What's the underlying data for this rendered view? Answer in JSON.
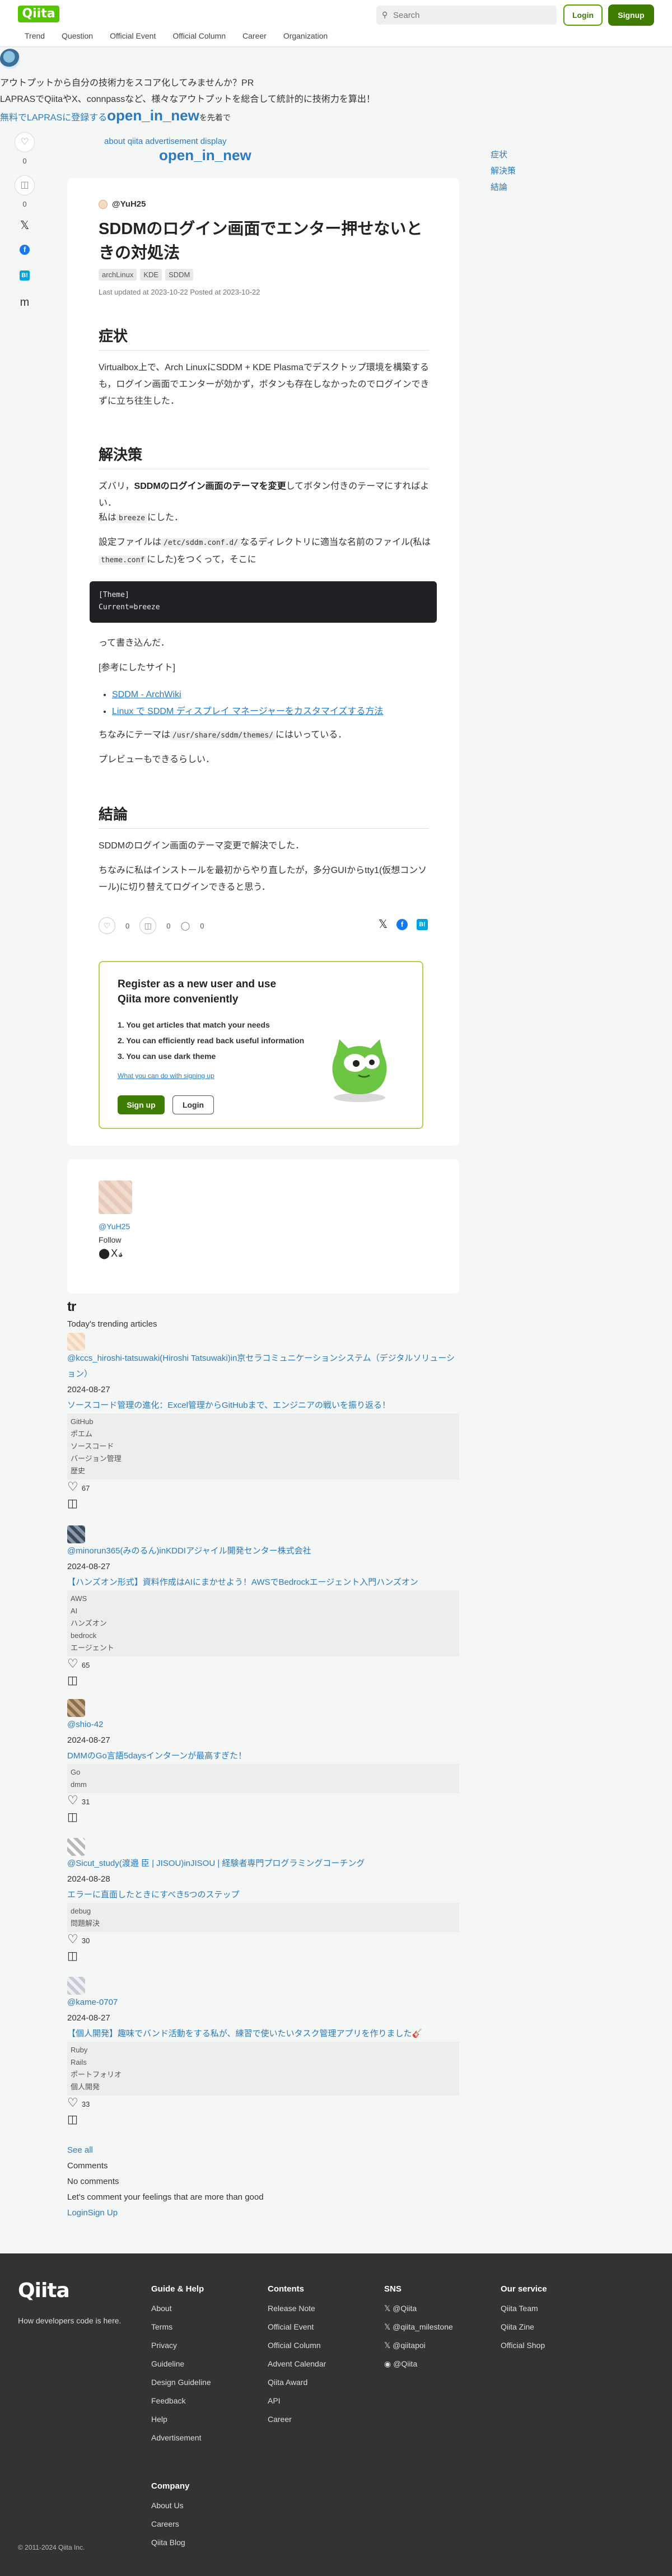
{
  "header": {
    "logo": "Qiita",
    "search_placeholder": "Search",
    "login": "Login",
    "signup": "Signup",
    "nav": [
      "Trend",
      "Question",
      "Official Event",
      "Official Column",
      "Career",
      "Organization"
    ]
  },
  "promo": {
    "line1": "アウトプットから自分の技術力をスコア化してみませんか？PR",
    "line2": "LAPRASでQiitaやX、connpassなど、様々なアウトプットを総合して統計的に技術力を算出！",
    "line3_link": "無料でLAPRASに登録する",
    "line3_big": "open_in_new",
    "line3_small": "を先着で"
  },
  "side_actions": {
    "like_count": "0",
    "stock_count": "0"
  },
  "ad": {
    "label": "about qiita advertisement display",
    "big": "open_in_new"
  },
  "toc": [
    "症状",
    "解決策",
    "結論"
  ],
  "article": {
    "author": "@YuH25",
    "title": "SDDMのログイン画面でエンター押せないときの対処法",
    "tags": [
      "archLinux",
      "KDE",
      "SDDM"
    ],
    "dates": "Last updated at 2023-10-22   Posted at 2023-10-22",
    "h_symptom": "症状",
    "p_symptom": "Virtualbox上で、Arch LinuxにSDDM + KDE Plasmaでデスクトップ環境を構築するも，ログイン画面でエンターが効かず，ボタンも存在しなかったのでログインできずに立ち往生した．",
    "h_solution": "解決策",
    "p_sol1_a": "ズバリ，",
    "p_sol1_b": "SDDMのログイン画面のテーマを変更",
    "p_sol1_c": "してボタン付きのテーマにすればよい．",
    "p_sol2_a": "私は",
    "p_sol2_code": "breeze",
    "p_sol2_b": "にした．",
    "p_sol3_a": "設定ファイルは",
    "p_sol3_code1": "/etc/sddm.conf.d/",
    "p_sol3_b": "なるディレクトリに適当な名前のファイル(私は",
    "p_sol3_code2": "theme.conf",
    "p_sol3_c": "にした)をつくって，そこに",
    "code_line1": "[Theme]",
    "code_line2": "Current=breeze",
    "p_after_code": "って書き込んだ．",
    "p_ref": "[参考にしたサイト]",
    "links": [
      "SDDM - ArchWiki",
      "Linux で SDDM ディスプレイ マネージャーをカスタマイズする方法"
    ],
    "p_theme_a": "ちなみにテーマは",
    "p_theme_code": "/usr/share/sddm/themes/",
    "p_theme_b": "にはいっている．",
    "p_preview": "プレビューもできるらしい．",
    "h_conclusion": "結論",
    "p_conc1": "SDDMのログイン画面のテーマ変更で解決でした．",
    "p_conc2": "ちなみに私はインストールを最初からやり直したが，多分GUIからtty1(仮想コンソール)に切り替えてログインできると思う．",
    "like_count": "0",
    "stock_count": "0",
    "comment_count": "0"
  },
  "register": {
    "title": "Register as a new user and use Qiita more conveniently",
    "items": [
      "1. You get articles that match your needs",
      "2. You can efficiently read back useful information",
      "3. You can use dark theme"
    ],
    "link": "What you can do with signing up",
    "signup": "Sign up",
    "login": "Login"
  },
  "author_card": {
    "name": "@YuH25",
    "follow": "Follow",
    "links": "⬤X𝓼"
  },
  "trending": {
    "logo": "tr",
    "heading": "Today's trending articles",
    "items": [
      {
        "author": "@kccs_hiroshi-tatsuwaki(Hiroshi Tatsuwaki)in京セラコミュニケーションシステム（デジタルソリューション）",
        "date": "2024-08-27",
        "title": "ソースコード管理の進化：Excel管理からGitHubまで、エンジニアの戦いを振り返る！",
        "tags": [
          "GitHub",
          "ポエム",
          "ソースコード",
          "バージョン管理",
          "歴史"
        ],
        "likes": "67"
      },
      {
        "author": "@minorun365(みのるん)inKDDIアジャイル開発センター株式会社",
        "date": "2024-08-27",
        "title": "【ハンズオン形式】資料作成はAIにまかせよう！AWSでBedrockエージェント入門ハンズオン",
        "tags": [
          "AWS",
          "AI",
          "ハンズオン",
          "bedrock",
          "エージェント"
        ],
        "likes": "65"
      },
      {
        "author": "@shio-42",
        "date": "2024-08-27",
        "title": "DMMのGo言語5daysインターンが最高すぎた！",
        "tags": [
          "Go",
          "dmm"
        ],
        "likes": "31"
      },
      {
        "author": "@Sicut_study(渡邉 臣 | JISOU)inJISOU | 経験者専門プログラミングコーチング",
        "date": "2024-08-28",
        "title": "エラーに直面したときにすべき5つのステップ",
        "tags": [
          "debug",
          "問題解決"
        ],
        "likes": "30"
      },
      {
        "author": "@kame-0707",
        "date": "2024-08-27",
        "title": "【個人開発】趣味でバンド活動をする私が、練習で使いたいタスク管理アプリを作りました🎸",
        "tags": [
          "Ruby",
          "Rails",
          "ポートフォリオ",
          "個人開発"
        ],
        "likes": "33"
      }
    ],
    "see_all": "See all"
  },
  "comments": {
    "heading": "Comments",
    "none": "No comments",
    "prompt": "Let's comment your feelings that are more than good",
    "login": "Login",
    "signup": "Sign Up"
  },
  "footer": {
    "logo": "Qiita",
    "tagline": "How developers code is here.",
    "guide_title": "Guide & Help",
    "guide": [
      "About",
      "Terms",
      "Privacy",
      "Guideline",
      "Design Guideline",
      "Feedback",
      "Help",
      "Advertisement"
    ],
    "contents_title": "Contents",
    "contents": [
      "Release Note",
      "Official Event",
      "Official Column",
      "Advent Calendar",
      "Qiita Award",
      "API",
      "Career"
    ],
    "sns_title": "SNS",
    "sns": [
      "@Qiita",
      "@qiita_milestone",
      "@qiitapoi",
      "@Qiita"
    ],
    "service_title": "Our service",
    "service": [
      "Qiita Team",
      "Qiita Zine",
      "Official Shop"
    ],
    "company_title": "Company",
    "company": [
      "About Us",
      "Careers",
      "Qiita Blog"
    ],
    "copyright": "© 2011-2024 Qiita Inc."
  }
}
